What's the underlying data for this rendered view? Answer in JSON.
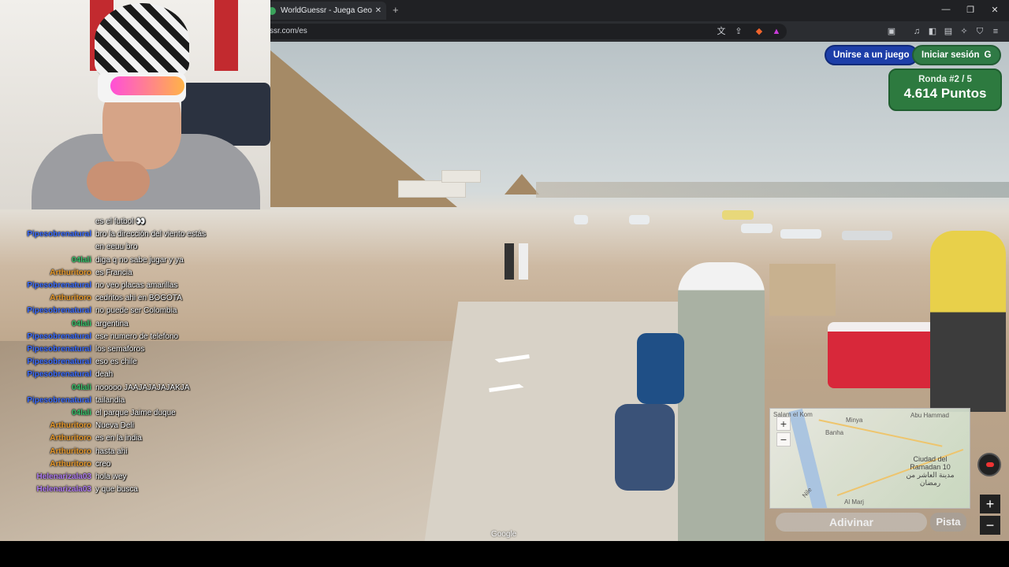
{
  "browser": {
    "tab_title": "WorldGuessr - Juega GeoGuessr",
    "tab_close": "✕",
    "new_tab": "+",
    "url": "ssr.com/es",
    "window_controls": {
      "minimize": "—",
      "restore": "❐",
      "close": "✕"
    }
  },
  "game": {
    "join_button": "Unirse a un juego",
    "login_button": "Iniciar sesión",
    "login_icon": "G",
    "round_label": "Ronda #2 / 5",
    "points_label": "4.614 Puntos",
    "guess_button": "Adivinar",
    "hint_button": "Pista",
    "google_watermark": "Google",
    "minimap": {
      "zoom_in": "+",
      "zoom_out": "−",
      "labels": {
        "salam": "Salam el Kom",
        "minya": "Minya",
        "abu_hammad": "Abu Hammad",
        "banha": "Banha",
        "nile": "Nile",
        "al_marj": "Al Marj",
        "city": "Ciudad del Ramadan 10",
        "city_ar": "مدينة العاشر من رمضان"
      }
    },
    "side_zoom_in": "+",
    "side_zoom_out": "−"
  },
  "chat": [
    {
      "user": "",
      "msg": "es el futbol 👀",
      "color": "#ffffff"
    },
    {
      "user": "Pipesobrenatural",
      "msg": "bro la dirección del viento estás",
      "color": "#3b6cff"
    },
    {
      "user": "",
      "msg": "en eeuu bro",
      "color": "#ffffff"
    },
    {
      "user": "04lali",
      "msg": "diga q no sabe jugar y ya",
      "color": "#35c26b"
    },
    {
      "user": "Arthuritoro",
      "msg": "es Francia",
      "color": "#e89a2c"
    },
    {
      "user": "Pipesobrenatural",
      "msg": "no veo placas amarillas",
      "color": "#3b6cff"
    },
    {
      "user": "Arthuritoro",
      "msg": "cedritos ahi en BOGOTA",
      "color": "#e89a2c"
    },
    {
      "user": "Pipesobrenatural",
      "msg": "no puede ser Colombia",
      "color": "#3b6cff"
    },
    {
      "user": "04lali",
      "msg": "argentina",
      "color": "#35c26b"
    },
    {
      "user": "Pipesobrenatural",
      "msg": "ese numero de telefono",
      "color": "#3b6cff"
    },
    {
      "user": "Pipesobrenatural",
      "msg": "los semaforos",
      "color": "#3b6cff"
    },
    {
      "user": "Pipesobrenatural",
      "msg": "eso es chile",
      "color": "#3b6cff"
    },
    {
      "user": "Pipesobrenatural",
      "msg": "deah",
      "color": "#3b6cff"
    },
    {
      "user": "04lali",
      "msg": "nooooo JAAJAJAJAJAKJA",
      "color": "#35c26b"
    },
    {
      "user": "Pipesobrenatural",
      "msg": "tailandia",
      "color": "#3b6cff"
    },
    {
      "user": "04lali",
      "msg": "el parque Jaime duque",
      "color": "#35c26b"
    },
    {
      "user": "Arthuritoro",
      "msg": "Nueva Deli",
      "color": "#e89a2c"
    },
    {
      "user": "Arthuritoro",
      "msg": "es en la india",
      "color": "#e89a2c"
    },
    {
      "user": "Arthuritoro",
      "msg": "hasta ahi",
      "color": "#e89a2c"
    },
    {
      "user": "Arthuritoro",
      "msg": "creo",
      "color": "#e89a2c"
    },
    {
      "user": "Helenarizala03",
      "msg": "hola wey",
      "color": "#b07cf2"
    },
    {
      "user": "Helenarizala03",
      "msg": "y que busca",
      "color": "#b07cf2"
    }
  ]
}
